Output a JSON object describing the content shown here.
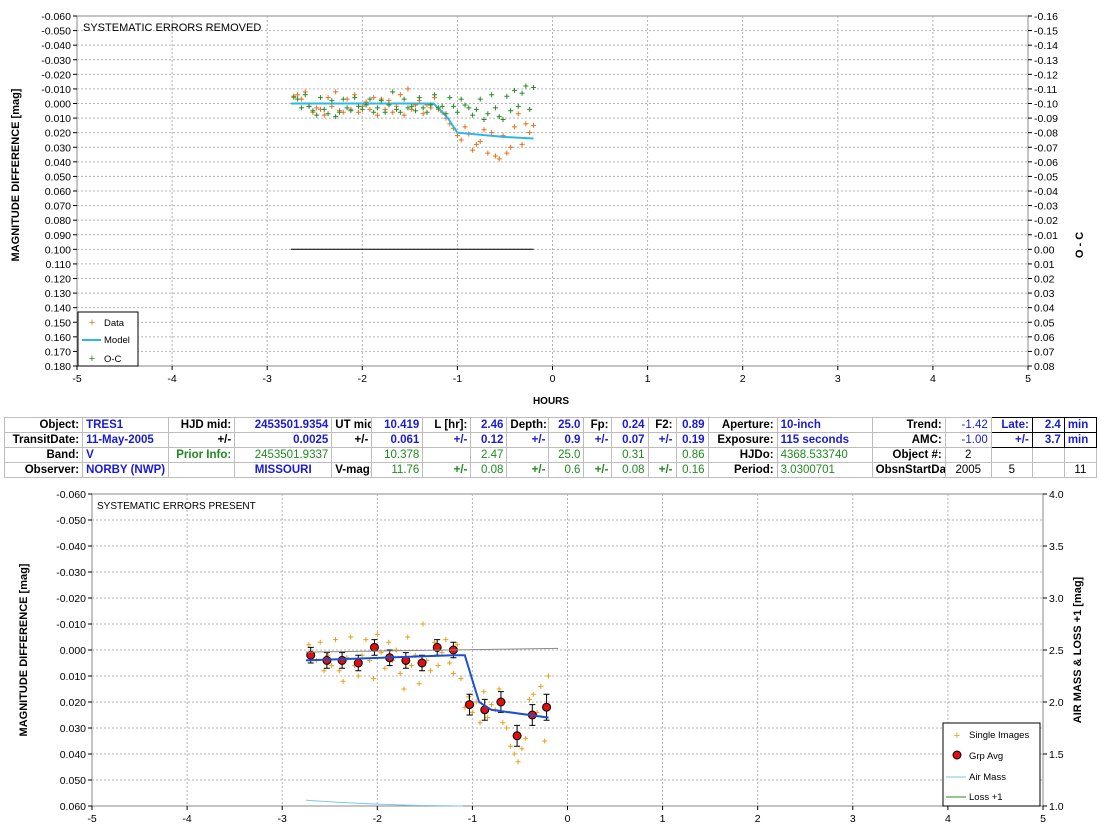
{
  "colors": {
    "data": "#e8701a",
    "model": "#2bb7e8",
    "oc": "#2a8a2a",
    "grp_avg": "#e01010",
    "grp_line": "#1a50d8",
    "air_mass": "#7ec8e8",
    "loss": "#2a8a2a",
    "grid": "#b4b4b4"
  },
  "chart_data": [
    {
      "type": "scatter",
      "title": "SYSTEMATIC ERRORS REMOVED",
      "xlabel": "HOURS",
      "ylabel": "MAGNITUDE DIFFERENCE [mag]",
      "y2label": "O - C",
      "xlim": [
        -5,
        5
      ],
      "ylim": [
        -0.06,
        0.18
      ],
      "y_inverted": true,
      "y2lim": [
        -0.16,
        0.08
      ],
      "xticks": [
        "-5",
        "-4",
        "-3",
        "-2",
        "-1",
        "0",
        "1",
        "2",
        "3",
        "4",
        "5"
      ],
      "yticks": [
        "-0.060",
        "-0.050",
        "-0.040",
        "-0.030",
        "-0.020",
        "-0.010",
        "0.000",
        "0.010",
        "0.020",
        "0.030",
        "0.040",
        "0.050",
        "0.060",
        "0.070",
        "0.080",
        "0.090",
        "0.100",
        "0.110",
        "0.120",
        "0.130",
        "0.140",
        "0.150",
        "0.160",
        "0.170",
        "0.180"
      ],
      "y2ticks": [
        "-0.16",
        "-0.15",
        "-0.14",
        "-0.13",
        "-0.12",
        "-0.11",
        "-0.10",
        "-0.09",
        "-0.08",
        "-0.07",
        "-0.06",
        "-0.05",
        "-0.04",
        "-0.03",
        "-0.02",
        "-0.01",
        "0.00",
        "0.01",
        "0.02",
        "0.03",
        "0.04",
        "0.05",
        "0.06",
        "0.07",
        "0.08"
      ],
      "grid": true,
      "legend_position": "bottom-left",
      "legend": [
        "Data",
        "Model",
        "O-C"
      ],
      "series": [
        {
          "name": "Data",
          "marker": "+",
          "x": [
            -2.72,
            -2.68,
            -2.64,
            -2.6,
            -2.56,
            -2.52,
            -2.48,
            -2.44,
            -2.4,
            -2.36,
            -2.32,
            -2.28,
            -2.24,
            -2.2,
            -2.16,
            -2.12,
            -2.08,
            -2.04,
            -2.0,
            -1.96,
            -1.92,
            -1.88,
            -1.84,
            -1.8,
            -1.76,
            -1.72,
            -1.68,
            -1.64,
            -1.6,
            -1.56,
            -1.52,
            -1.48,
            -1.44,
            -1.4,
            -1.36,
            -1.32,
            -1.28,
            -1.24,
            -1.2,
            -1.16,
            -1.12,
            -1.08,
            -1.04,
            -1.0,
            -0.96,
            -0.92,
            -0.88,
            -0.84,
            -0.8,
            -0.76,
            -0.72,
            -0.68,
            -0.64,
            -0.6,
            -0.56,
            -0.52,
            -0.48,
            -0.44,
            -0.4,
            -0.36,
            -0.32,
            -0.28,
            -0.24,
            -0.2
          ],
          "y": [
            -0.004,
            -0.006,
            -0.003,
            -0.008,
            0.002,
            0.006,
            0.003,
            0.004,
            0.008,
            -0.004,
            0.002,
            -0.008,
            0.005,
            0.006,
            -0.003,
            0.004,
            -0.006,
            0.006,
            0.002,
            -0.001,
            0.004,
            -0.004,
            0.008,
            -0.003,
            0.004,
            -0.002,
            0.006,
            0.002,
            -0.006,
            0.008,
            -0.01,
            0.004,
            0.001,
            -0.002,
            0.007,
            0.001,
            0.003,
            -0.004,
            0.004,
            0.006,
            0.01,
            0.014,
            0.017,
            0.022,
            0.025,
            0.016,
            0.021,
            0.032,
            0.028,
            0.026,
            0.018,
            0.034,
            0.02,
            0.036,
            0.038,
            0.022,
            0.034,
            0.03,
            0.016,
            0.007,
            0.028,
            0.014,
            0.02,
            0.015
          ]
        },
        {
          "name": "Model",
          "x": [
            -2.75,
            -1.25,
            -1.1,
            -1.0,
            -0.5,
            -0.2
          ],
          "y": [
            0.0,
            0.0,
            0.01,
            0.02,
            0.023,
            0.024
          ]
        },
        {
          "name": "O-C",
          "marker": "+",
          "x": [
            -2.72,
            -2.68,
            -2.64,
            -2.6,
            -2.56,
            -2.52,
            -2.48,
            -2.44,
            -2.4,
            -2.36,
            -2.32,
            -2.28,
            -2.24,
            -2.2,
            -2.16,
            -2.12,
            -2.08,
            -2.04,
            -2.0,
            -1.96,
            -1.92,
            -1.88,
            -1.84,
            -1.8,
            -1.76,
            -1.72,
            -1.68,
            -1.64,
            -1.6,
            -1.56,
            -1.52,
            -1.48,
            -1.44,
            -1.4,
            -1.36,
            -1.32,
            -1.28,
            -1.24,
            -1.2,
            -1.16,
            -1.12,
            -1.08,
            -1.04,
            -1.0,
            -0.96,
            -0.92,
            -0.88,
            -0.84,
            -0.8,
            -0.76,
            -0.72,
            -0.68,
            -0.64,
            -0.6,
            -0.56,
            -0.52,
            -0.48,
            -0.44,
            -0.4,
            -0.36,
            -0.32,
            -0.28,
            -0.24,
            -0.2
          ],
          "y": [
            -0.005,
            -0.003,
            0.003,
            -0.006,
            0.002,
            0.005,
            0.008,
            -0.004,
            0.004,
            0.007,
            -0.002,
            0.009,
            0.006,
            -0.003,
            0.003,
            0.005,
            -0.004,
            0.002,
            0.004,
            0.001,
            -0.003,
            0.006,
            0.003,
            -0.002,
            0.006,
            0.001,
            -0.008,
            0.004,
            0.006,
            -0.003,
            0.003,
            0.002,
            0.005,
            -0.004,
            0.003,
            0.006,
            0.001,
            -0.006,
            0.003,
            0.002,
            0.007,
            -0.004,
            0.002,
            0.006,
            -0.003,
            0.001,
            0.003,
            0.008,
            0.004,
            -0.003,
            0.011,
            0.007,
            -0.006,
            0.003,
            0.009,
            0.011,
            -0.005,
            0.005,
            -0.009,
            0.002,
            -0.007,
            -0.012,
            0.004,
            -0.011
          ]
        },
        {
          "name": "O-C zero",
          "x": [
            -2.75,
            -0.2
          ],
          "y": [
            0.1,
            0.1
          ]
        }
      ]
    },
    {
      "type": "scatter",
      "title": "SYSTEMATIC ERRORS PRESENT",
      "xlabel": "",
      "ylabel": "MAGNITUDE DIFFERENCE [mag]",
      "y2label": "AIR MASS & LOSS +1 [mag]",
      "xlim": [
        -5,
        5
      ],
      "ylim": [
        -0.06,
        0.06
      ],
      "y_inverted": true,
      "y2lim": [
        1.0,
        4.0
      ],
      "xticks": [
        "-5",
        "-4",
        "-3",
        "-2",
        "-1",
        "0",
        "1",
        "2",
        "3",
        "4",
        "5"
      ],
      "yticks": [
        "-0.060",
        "-0.050",
        "-0.040",
        "-0.030",
        "-0.020",
        "-0.010",
        "0.000",
        "0.010",
        "0.020",
        "0.030",
        "0.040",
        "0.050",
        "0.060"
      ],
      "y2ticks": [
        "1.0",
        "1.5",
        "2.0",
        "2.5",
        "3.0",
        "3.5",
        "4.0"
      ],
      "grid": true,
      "legend_position": "bottom-right",
      "legend": [
        "Single Images",
        "Grp Avg",
        "Air Mass",
        "Loss +1"
      ],
      "series": [
        {
          "name": "Single Images",
          "marker": "+",
          "x": [
            -2.72,
            -2.68,
            -2.64,
            -2.6,
            -2.56,
            -2.52,
            -2.48,
            -2.44,
            -2.4,
            -2.36,
            -2.32,
            -2.28,
            -2.24,
            -2.2,
            -2.16,
            -2.12,
            -2.08,
            -2.04,
            -2.0,
            -1.96,
            -1.92,
            -1.88,
            -1.84,
            -1.8,
            -1.76,
            -1.72,
            -1.68,
            -1.64,
            -1.6,
            -1.56,
            -1.52,
            -1.48,
            -1.44,
            -1.4,
            -1.36,
            -1.32,
            -1.28,
            -1.24,
            -1.2,
            -1.16,
            -1.12,
            -1.08,
            -1.04,
            -1.0,
            -0.96,
            -0.92,
            -0.88,
            -0.84,
            -0.8,
            -0.76,
            -0.72,
            -0.68,
            -0.64,
            -0.6,
            -0.56,
            -0.52,
            -0.48,
            -0.44,
            -0.4,
            -0.36,
            -0.32,
            -0.28,
            -0.24,
            -0.2
          ],
          "y": [
            -0.002,
            0.001,
            0.004,
            -0.003,
            0.008,
            0.002,
            0.006,
            -0.004,
            0.008,
            0.012,
            0.003,
            -0.005,
            0.006,
            0.01,
            0.002,
            -0.004,
            0.004,
            0.011,
            -0.006,
            0.001,
            0.007,
            -0.003,
            0.004,
            0.0,
            0.009,
            0.015,
            -0.005,
            0.006,
            0.002,
            0.013,
            -0.01,
            0.004,
            0.008,
            -0.003,
            0.006,
            0.001,
            -0.004,
            0.005,
            0.009,
            -0.002,
            0.011,
            0.022,
            0.018,
            0.024,
            0.02,
            0.028,
            0.016,
            0.026,
            0.021,
            0.023,
            0.015,
            0.028,
            0.03,
            0.037,
            0.04,
            0.043,
            0.038,
            0.034,
            0.019,
            0.017,
            0.024,
            0.014,
            0.035,
            0.01
          ]
        },
        {
          "name": "Grp Avg",
          "x": [
            -2.7,
            -2.53,
            -2.37,
            -2.2,
            -2.03,
            -1.87,
            -1.7,
            -1.53,
            -1.37,
            -1.2,
            -1.03,
            -0.87,
            -0.7,
            -0.53,
            -0.37,
            -0.22
          ],
          "y": [
            0.002,
            0.004,
            0.004,
            0.005,
            -0.001,
            0.003,
            0.004,
            0.005,
            -0.001,
            0.0,
            0.021,
            0.023,
            0.02,
            0.033,
            0.025,
            0.022
          ],
          "err": [
            0.003,
            0.003,
            0.003,
            0.003,
            0.003,
            0.003,
            0.003,
            0.003,
            0.003,
            0.003,
            0.004,
            0.004,
            0.004,
            0.004,
            0.004,
            0.005
          ]
        },
        {
          "name": "Grp Avg model",
          "x": [
            -2.75,
            -1.2,
            -1.08,
            -0.93,
            -0.8,
            -0.2
          ],
          "y": [
            0.004,
            0.002,
            0.002,
            0.02,
            0.023,
            0.026
          ]
        },
        {
          "name": "Air Mass",
          "axis": "y2",
          "x": [
            -2.75,
            -2.4,
            -2.0,
            -1.6,
            -1.3,
            -1.1
          ],
          "y": [
            1.055,
            1.035,
            1.018,
            1.006,
            1.002,
            1.0
          ]
        },
        {
          "name": "Loss +1",
          "axis": "y2",
          "x": [
            -2.75,
            -0.1
          ],
          "y": [
            2.48,
            2.515
          ]
        }
      ]
    }
  ],
  "info_table": {
    "row1": {
      "object_label": "Object:",
      "object": "TRES1",
      "hjd_mid_label": "HJD mid:",
      "hjd_mid": "2453501.9354",
      "ut_mid_label": "UT mid:",
      "ut_mid": "10.419",
      "l_hr_label": "L [hr]:",
      "l_hr": "2.46",
      "depth_label": "Depth:",
      "depth": "25.0",
      "fp_label": "Fp:",
      "fp": "0.24",
      "f2_label": "F2:",
      "f2": "0.89",
      "aperture_label": "Aperture:",
      "aperture": "10-inch",
      "trend_label": "Trend:",
      "trend": "-1.42",
      "late_label": "Late:",
      "late": "2.4",
      "late_unit": "min"
    },
    "row2": {
      "transit_date_label": "TransitDate:",
      "transit_date": "11-May-2005",
      "pm1": "+/-",
      "hjd_err": "0.0025",
      "pm2": "+/-",
      "ut_err": "0.061",
      "pm3": "+/-",
      "l_err": "0.12",
      "pm4": "+/-",
      "depth_err": "0.9",
      "pm5": "+/-",
      "fp_err": "0.07",
      "pm6": "+/-",
      "f2_err": "0.19",
      "exposure_label": "Exposure:",
      "exposure": "115 seconds",
      "amc_label": "AMC:",
      "amc": "-1.00",
      "pm7": "+/-",
      "late_err": "3.7",
      "late_err_unit": "min"
    },
    "row3": {
      "band_label": "Band:",
      "band": "V",
      "prior_label": "Prior Info:",
      "prior_hjd": "2453501.9337",
      "prior_ut": "10.378",
      "prior_l": "2.47",
      "prior_depth": "25.0",
      "prior_fp": "0.31",
      "prior_f2": "0.86",
      "hjdo_label": "HJDo:",
      "hjdo": "4368.533740",
      "objnum_label": "Object #:",
      "objnum": "2"
    },
    "row4": {
      "observer_label": "Observer:",
      "observer": "NORBY (NWP)",
      "location": "MISSOURI",
      "vmag_label": "V-mag:",
      "vmag": "11.76",
      "pm8": "+/-",
      "vmag_l_err": "0.08",
      "pm9": "+/-",
      "vmag_d_err": "0.6",
      "pm10": "+/-",
      "vmag_fp_err": "0.08",
      "pm11": "+/-",
      "vmag_f2_err": "0.16",
      "period_label": "Period:",
      "period": "3.0300701",
      "obs_start_label": "ObsnStartDate:",
      "obs_year": "2005",
      "obs_month": "5",
      "obs_day": "11"
    }
  }
}
